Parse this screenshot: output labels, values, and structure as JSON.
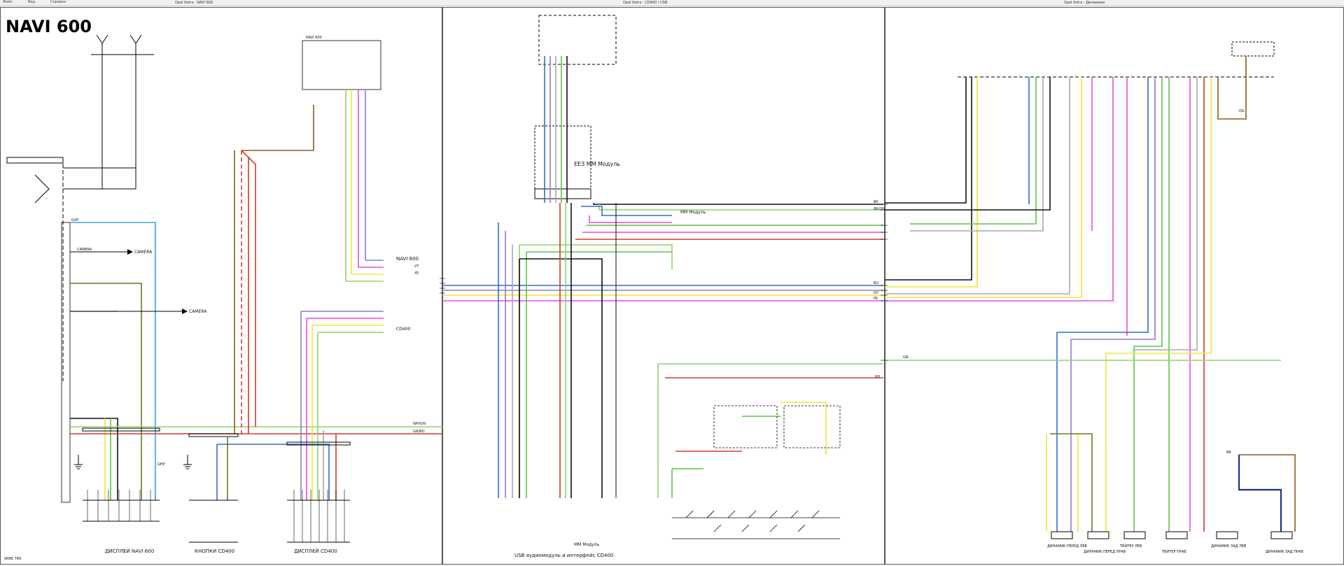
{
  "toolbar": {
    "buttons": [
      "Файл",
      "Вид",
      "Справка"
    ]
  },
  "sheets": [
    {
      "title": "Opel Astra - NAVI 600"
    },
    {
      "title": "Opel Astra - CD400 / USB"
    },
    {
      "title": "Opel Astra - Динамики"
    }
  ],
  "headline": "NAVI 600",
  "modules": {
    "navi_label_1": "NAVI 600",
    "navi_label_2": "NAVI 600",
    "cd400_label": "CD400",
    "usb_label": "USB аудиомодуль и интерфейс CD400",
    "mm_label_1": "ММ Модуль",
    "mm_label_2": "ММ Модуль",
    "camera_1": "CAMERA",
    "camera_2": "CAMERA",
    "display_1": "ДИСПЛЕЙ NAVI 600",
    "display_2": "КНОПКИ CD400",
    "display_3": "ДИСПЛЕЙ CD400",
    "mm_module_big": "ЕЕЗ ММ Модуль"
  },
  "wire_labels": {
    "gvp": "GVP",
    "ghp": "GHP",
    "cable": "CAMERA",
    "wh_gn": "WH/GN",
    "gn_rd": "GN/RD",
    "ye": "YE",
    "vt": "VT",
    "bk": "BK",
    "bu": "BU",
    "gy": "GY",
    "og": "OG",
    "gn": "GN",
    "rd": "RD",
    "br": "BR",
    "pk": "PK",
    "bk_gn": "BK/GN"
  },
  "speakers": [
    {
      "label": "ДИНАМИК ПЕРЕД ЛЕВ"
    },
    {
      "label": "ДИНАМИК ПЕРЕД ПРАВ"
    },
    {
      "label": "ТВИТЕР ЛЕВ"
    },
    {
      "label": "ТВИТЕР ПРАВ"
    },
    {
      "label": "ДИНАМИК ЗАД ЛЕВ"
    },
    {
      "label": "ДИНАМИК ЗАД ПРАВ"
    }
  ],
  "footer_left": "WIRE 789",
  "wire_colors": {
    "red": "#d23a2e",
    "brown": "#8a5a1e",
    "yellow": "#efe63a",
    "green": "#5ec24a",
    "lightgreen": "#8ed36b",
    "blue": "#2e6fd0",
    "lightblue": "#38a4e0",
    "pink": "#e64fd9",
    "violet": "#8a7bd6",
    "black": "#111111",
    "gray": "#a9a9a9",
    "olive": "#6a7a1a",
    "navy": "#1a2f8f"
  }
}
